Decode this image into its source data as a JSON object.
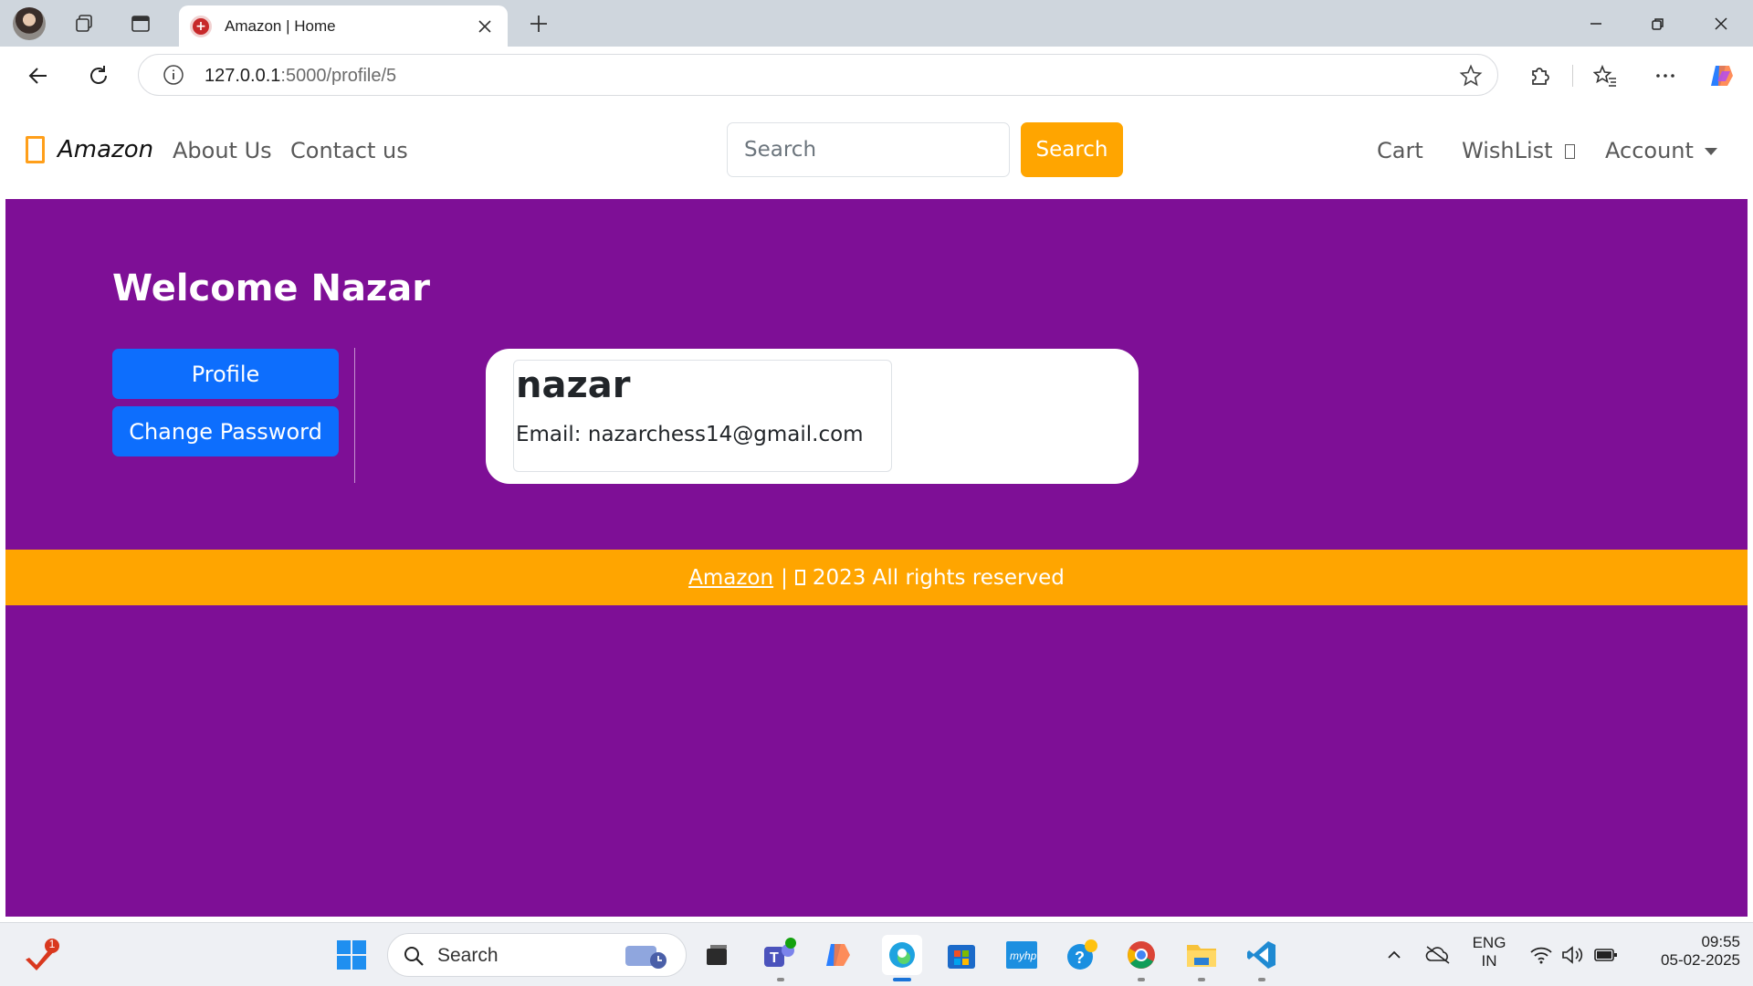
{
  "browser": {
    "tab_title": "Amazon | Home",
    "url_host": "127.0.0.1",
    "url_path": ":5000/profile/5"
  },
  "site": {
    "brand": "Amazon",
    "nav_links": [
      "About Us",
      "Contact us"
    ],
    "search_placeholder": "Search",
    "search_button": "Search",
    "right_links": {
      "cart": "Cart",
      "wishlist": "WishList",
      "account": "Account"
    },
    "welcome": "Welcome Nazar",
    "buttons": {
      "profile": "Profile",
      "change_password": "Change Password"
    },
    "profile": {
      "name": "nazar",
      "email": "Email: nazarchess14@gmail.com"
    },
    "footer": {
      "link": "Amazon",
      "separator": "|",
      "text": "2023 All rights reserved"
    },
    "colors": {
      "background": "#7e0f96",
      "accent": "#ffa500",
      "primary_button": "#0d6efd"
    }
  },
  "taskbar": {
    "search_label": "Search",
    "lang_line1": "ENG",
    "lang_line2": "IN",
    "time": "09:55",
    "date": "05-02-2025",
    "notification_count": "1"
  }
}
